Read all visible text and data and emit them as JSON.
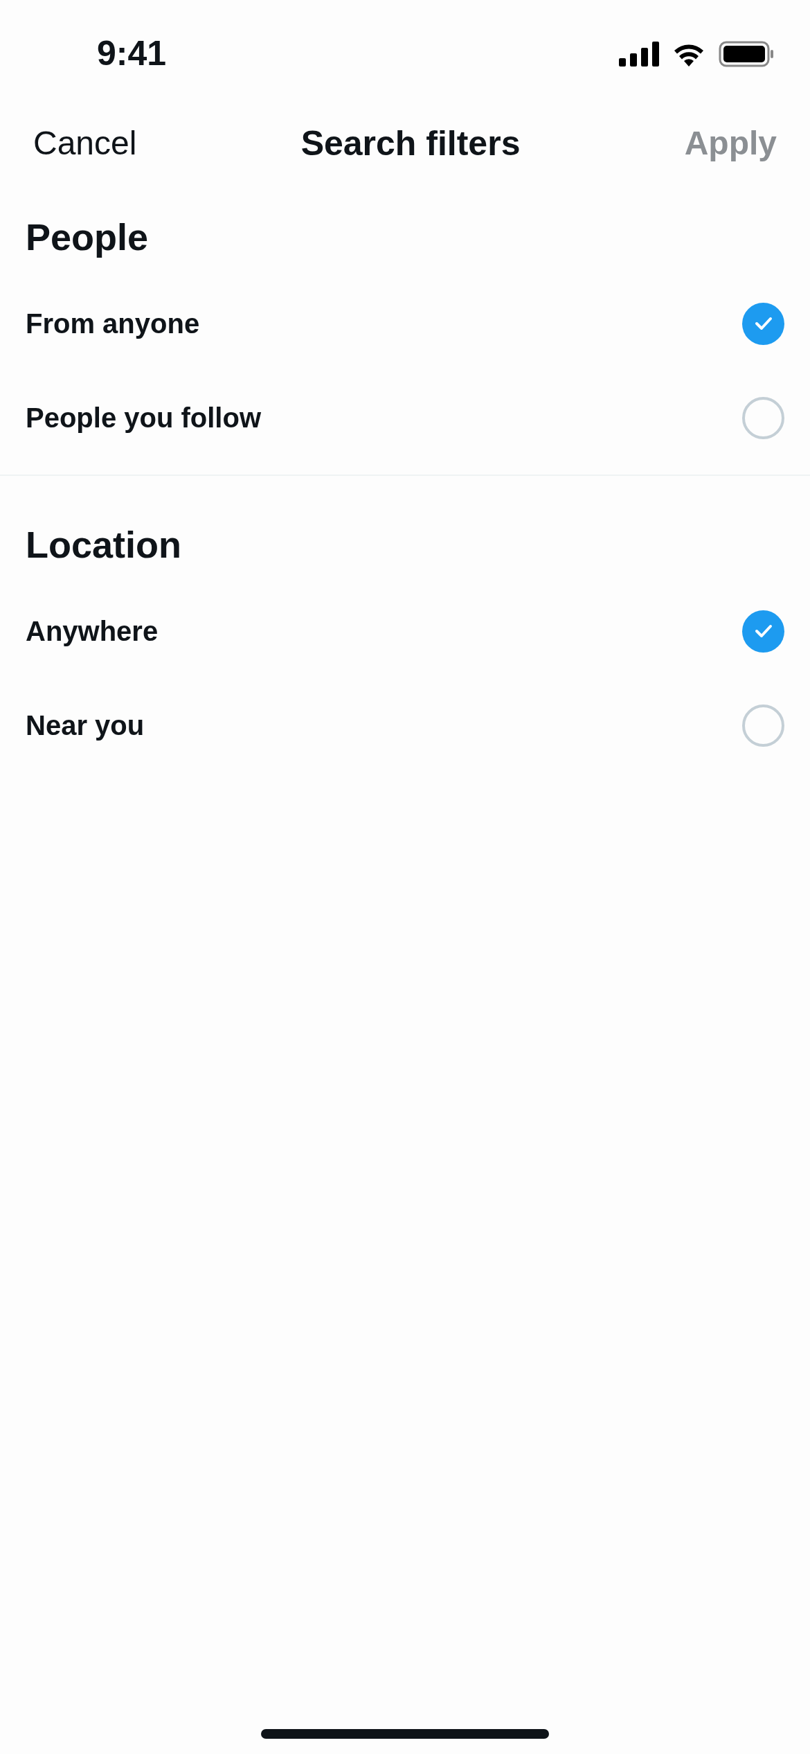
{
  "status_bar": {
    "time": "9:41"
  },
  "header": {
    "cancel": "Cancel",
    "title": "Search filters",
    "apply": {
      "label": "Apply",
      "disabled": true
    }
  },
  "sections": [
    {
      "title": "People",
      "options": [
        {
          "label": "From anyone",
          "selected": true
        },
        {
          "label": "People you follow",
          "selected": false
        }
      ]
    },
    {
      "title": "Location",
      "options": [
        {
          "label": "Anywhere",
          "selected": true
        },
        {
          "label": "Near you",
          "selected": false
        }
      ]
    }
  ]
}
